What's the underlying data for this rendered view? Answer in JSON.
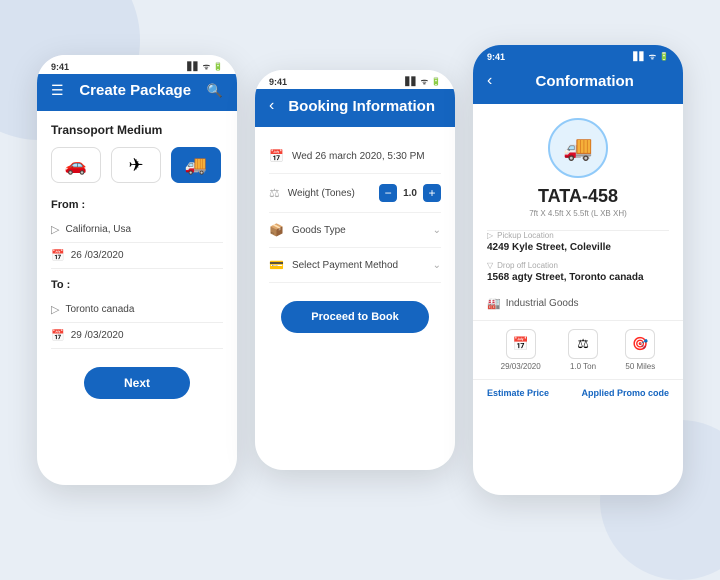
{
  "app": {
    "status_time": "9:41",
    "signal_icons": "▋▋ ᯤ 🔋"
  },
  "phone1": {
    "header_title": "Create Package",
    "section_transport": "Transoport Medium",
    "transport_options": [
      {
        "icon": "🚗",
        "active": false
      },
      {
        "icon": "✈",
        "active": false
      },
      {
        "icon": "🚚",
        "active": true
      }
    ],
    "from_label": "From :",
    "from_location": "California, Usa",
    "from_date": "26 /03/2020",
    "to_label": "To :",
    "to_location": "Toronto canada",
    "to_date": "29 /03/2020",
    "next_btn": "Next"
  },
  "phone2": {
    "header_title": "Booking Information",
    "datetime": "Wed 26 march 2020,  5:30 PM",
    "weight_label": "Weight (Tones)",
    "weight_value": "1.0",
    "goods_label": "Goods Type",
    "payment_label": "Select Payment Method",
    "proceed_btn": "Proceed to Book"
  },
  "phone3": {
    "header_title": "Conformation",
    "truck_icon": "🚚",
    "vehicle_id": "TATA-458",
    "vehicle_dims": "7ft X 4.5ft X 5.5ft (L XB XH)",
    "pickup_label": "Pickup Location",
    "pickup_value": "4249 Kyle Street, Coleville",
    "dropoff_label": "Drop off Location",
    "dropoff_value": "1568 agty Street, Toronto canada",
    "goods_type": "Industrial Goods",
    "date_icon": "📅",
    "date_value": "29/03/2020",
    "weight_icon": "⚖",
    "weight_value": "1.0 Ton",
    "miles_icon": "🎯",
    "miles_value": "50 Miles",
    "estimate_label": "Estimate Price",
    "promo_label": "Applied Promo code"
  }
}
